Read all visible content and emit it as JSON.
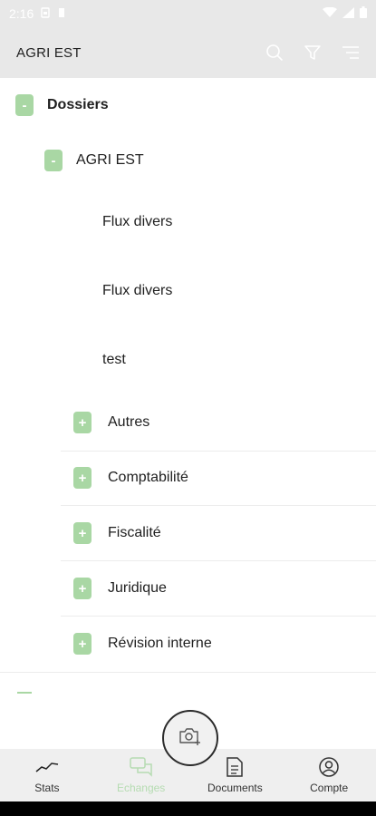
{
  "status": {
    "time": "2:16"
  },
  "appbar": {
    "title": "AGRI EST",
    "icons": [
      "search-icon",
      "filter-icon",
      "sort-icon"
    ]
  },
  "tree": {
    "root": {
      "toggle": "-",
      "label": "Dossiers"
    },
    "folder": {
      "toggle": "-",
      "label": "AGRI EST"
    },
    "files": [
      "Flux divers",
      "Flux divers",
      "test"
    ],
    "subfolders": [
      {
        "toggle": "+",
        "label": "Autres"
      },
      {
        "toggle": "+",
        "label": "Comptabilité"
      },
      {
        "toggle": "+",
        "label": "Fiscalité"
      },
      {
        "toggle": "+",
        "label": "Juridique"
      },
      {
        "toggle": "+",
        "label": "Révision interne"
      }
    ]
  },
  "tabs": [
    {
      "label": "Stats",
      "icon": "chart-line-icon"
    },
    {
      "label": "Echanges",
      "icon": "chat-icon",
      "active": true
    },
    {
      "label": "Documents",
      "icon": "document-icon"
    },
    {
      "label": "Compte",
      "icon": "account-icon"
    }
  ],
  "colors": {
    "accent": "#a9d7a4",
    "accent_light": "#b6dcb2",
    "appbar": "#e8e8e8"
  }
}
